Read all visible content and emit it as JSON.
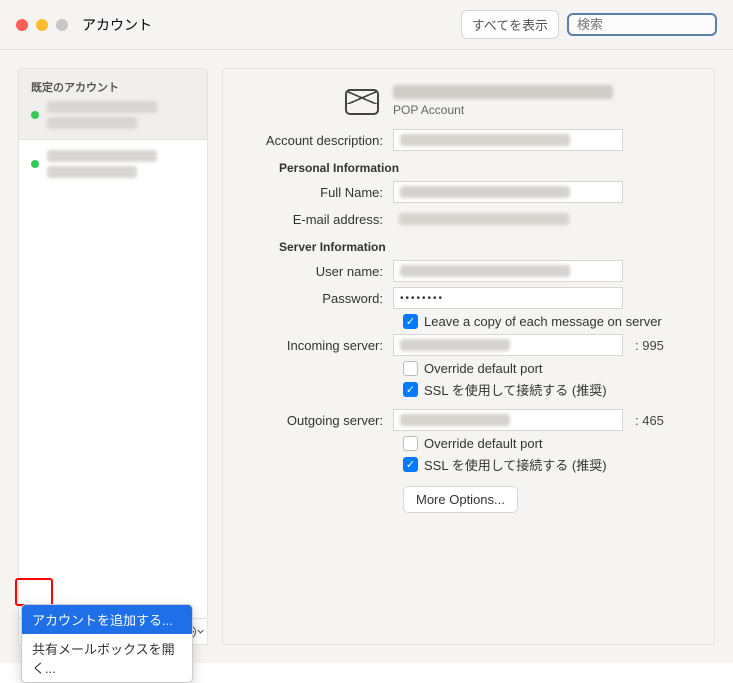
{
  "titlebar": {
    "title": "アカウント",
    "show_all": "すべてを表示",
    "search_placeholder": "検索"
  },
  "sidebar": {
    "default_label": "既定のアカウント",
    "bottom": {
      "add": "+",
      "remove": "−",
      "gear": "⋯"
    },
    "menu": {
      "add_account": "アカウントを追加する...",
      "open_shared": "共有メールボックスを開く..."
    }
  },
  "main": {
    "subtype": "POP Account",
    "labels": {
      "account_description": "Account description:",
      "personal_info": "Personal Information",
      "full_name": "Full Name:",
      "email": "E-mail address:",
      "server_info": "Server Information",
      "user_name": "User name:",
      "password": "Password:",
      "leave_copy": "Leave a copy of each message on server",
      "incoming": "Incoming server:",
      "override_port": "Override default port",
      "ssl_connect": "SSL を使用して接続する (推奨)",
      "outgoing": "Outgoing server:",
      "more_options": "More Options..."
    },
    "password_mask": "••••••••",
    "incoming_port": ": 995",
    "outgoing_port": ": 465",
    "checks": {
      "leave_copy": true,
      "in_override": false,
      "in_ssl": true,
      "out_override": false,
      "out_ssl": true
    }
  }
}
